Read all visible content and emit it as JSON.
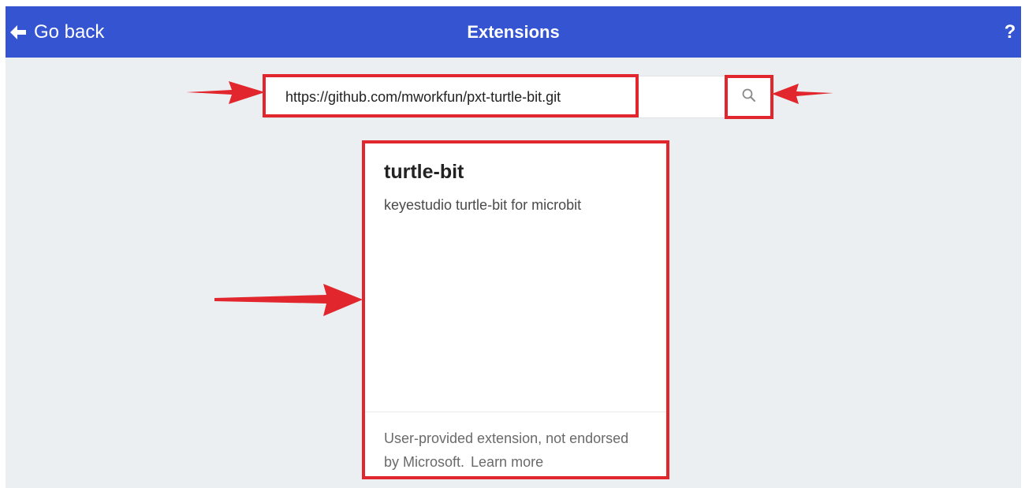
{
  "header": {
    "back_label": "Go back",
    "title": "Extensions",
    "help_label": "?",
    "back_icon": "arrow-left-icon",
    "bar_color": "#3454d1"
  },
  "search": {
    "value": "https://github.com/mworkfun/pxt-turtle-bit.git",
    "button_icon": "search-icon"
  },
  "result_card": {
    "title": "turtle-bit",
    "description": "keyestudio turtle-bit for microbit",
    "footer_text": "User-provided extension, not endorsed by Microsoft.",
    "learn_more": "Learn more"
  },
  "annotations": {
    "highlight_color": "#e1262d",
    "arrows": [
      "pointer-arrow-input",
      "pointer-arrow-search-button",
      "pointer-arrow-card"
    ]
  }
}
